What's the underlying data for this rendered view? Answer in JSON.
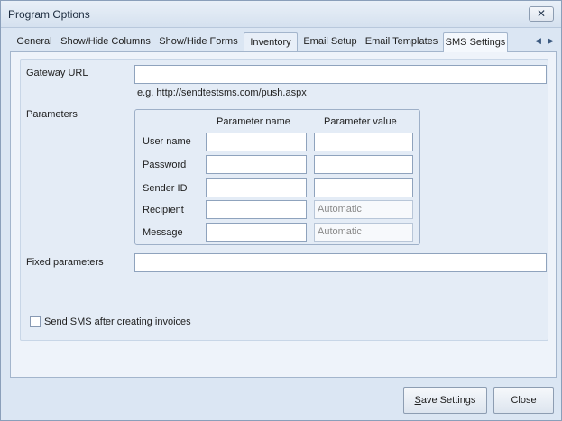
{
  "window": {
    "title": "Program Options",
    "close_glyph": "✕"
  },
  "tabs": [
    {
      "label": "General"
    },
    {
      "label": "Show/Hide Columns"
    },
    {
      "label": "Show/Hide Forms"
    },
    {
      "label": "Inventory"
    },
    {
      "label": "Email Setup"
    },
    {
      "label": "Email Templates"
    },
    {
      "label": "SMS Settings"
    }
  ],
  "tab_nav": {
    "left_glyph": "◀",
    "right_glyph": "▶"
  },
  "sms": {
    "gateway_url": {
      "label": "Gateway URL",
      "value": "",
      "hint": "e.g. http://sendtestsms.com/push.aspx"
    },
    "parameters": {
      "label": "Parameters",
      "col_name": "Parameter name",
      "col_value": "Parameter value",
      "rows": [
        {
          "label": "User name",
          "name": "",
          "value": ""
        },
        {
          "label": "Password",
          "name": "",
          "value": ""
        },
        {
          "label": "Sender ID",
          "name": "",
          "value": ""
        },
        {
          "label": "Recipient",
          "name": "",
          "value": "Automatic"
        },
        {
          "label": "Message",
          "name": "",
          "value": "Automatic"
        }
      ]
    },
    "fixed_parameters": {
      "label": "Fixed parameters",
      "value": ""
    },
    "send_after_invoice": {
      "label": "Send SMS after creating invoices",
      "checked": false
    }
  },
  "footer": {
    "save_label": "Save Settings",
    "save_accel": "S",
    "save_rest": "ave Settings",
    "close_label": "Close"
  }
}
